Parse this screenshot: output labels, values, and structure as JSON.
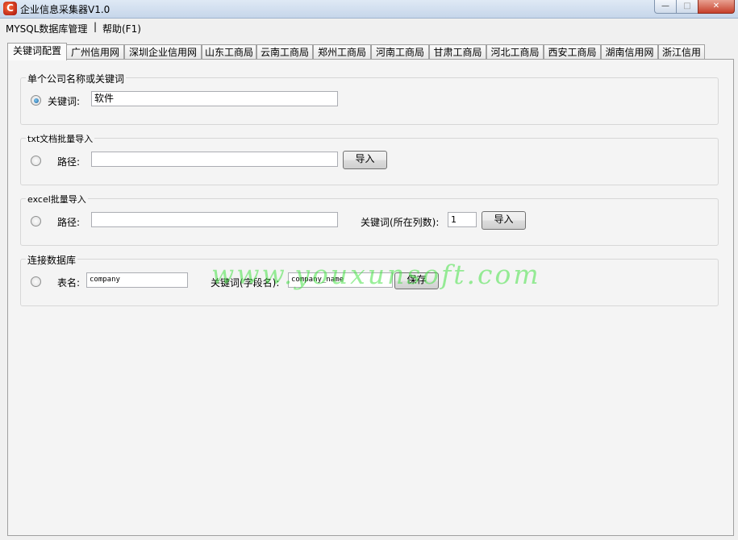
{
  "window": {
    "title": "企业信息采集器V1.0",
    "icon_letter": "C",
    "minimize_glyph": "—",
    "maximize_glyph": "□",
    "close_glyph": "✕"
  },
  "menu": {
    "db_manage": "MYSQL数据库管理",
    "separator": "|",
    "help": "帮助(F1)"
  },
  "tabs": [
    "关键词配置",
    "广州信用网",
    "深圳企业信用网",
    "山东工商局",
    "云南工商局",
    "郑州工商局",
    "河南工商局",
    "甘肃工商局",
    "河北工商局",
    "西安工商局",
    "湖南信用网",
    "浙江信用"
  ],
  "group_single": {
    "title": "单个公司名称或关键词",
    "keyword_label": "关键词:",
    "keyword_value": "软件"
  },
  "group_txt": {
    "title": "txt文档批量导入",
    "path_label": "路径:",
    "path_value": "",
    "import_button": "导入"
  },
  "group_excel": {
    "title": "excel批量导入",
    "path_label": "路径:",
    "path_value": "",
    "column_label": "关键词(所在列数):",
    "column_value": "1",
    "import_button": "导入"
  },
  "group_db": {
    "title": "连接数据库",
    "table_label": "表名:",
    "table_value": "company",
    "field_label": "关键词(字段名):",
    "field_value": "company_name",
    "save_button": "保存"
  },
  "watermark": "www.youxunsoft.com"
}
